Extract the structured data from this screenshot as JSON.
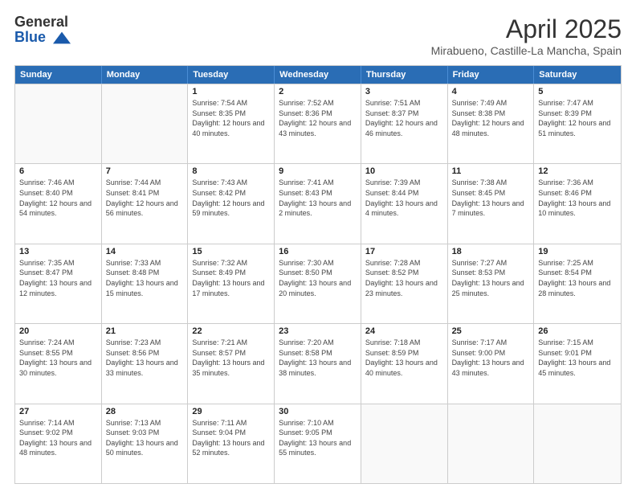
{
  "logo": {
    "general": "General",
    "blue": "Blue"
  },
  "header": {
    "month": "April 2025",
    "location": "Mirabueno, Castille-La Mancha, Spain"
  },
  "days_of_week": [
    "Sunday",
    "Monday",
    "Tuesday",
    "Wednesday",
    "Thursday",
    "Friday",
    "Saturday"
  ],
  "weeks": [
    [
      {
        "day": "",
        "sunrise": "",
        "sunset": "",
        "daylight": "",
        "empty": true
      },
      {
        "day": "",
        "sunrise": "",
        "sunset": "",
        "daylight": "",
        "empty": true
      },
      {
        "day": "1",
        "sunrise": "Sunrise: 7:54 AM",
        "sunset": "Sunset: 8:35 PM",
        "daylight": "Daylight: 12 hours and 40 minutes.",
        "empty": false
      },
      {
        "day": "2",
        "sunrise": "Sunrise: 7:52 AM",
        "sunset": "Sunset: 8:36 PM",
        "daylight": "Daylight: 12 hours and 43 minutes.",
        "empty": false
      },
      {
        "day": "3",
        "sunrise": "Sunrise: 7:51 AM",
        "sunset": "Sunset: 8:37 PM",
        "daylight": "Daylight: 12 hours and 46 minutes.",
        "empty": false
      },
      {
        "day": "4",
        "sunrise": "Sunrise: 7:49 AM",
        "sunset": "Sunset: 8:38 PM",
        "daylight": "Daylight: 12 hours and 48 minutes.",
        "empty": false
      },
      {
        "day": "5",
        "sunrise": "Sunrise: 7:47 AM",
        "sunset": "Sunset: 8:39 PM",
        "daylight": "Daylight: 12 hours and 51 minutes.",
        "empty": false
      }
    ],
    [
      {
        "day": "6",
        "sunrise": "Sunrise: 7:46 AM",
        "sunset": "Sunset: 8:40 PM",
        "daylight": "Daylight: 12 hours and 54 minutes.",
        "empty": false
      },
      {
        "day": "7",
        "sunrise": "Sunrise: 7:44 AM",
        "sunset": "Sunset: 8:41 PM",
        "daylight": "Daylight: 12 hours and 56 minutes.",
        "empty": false
      },
      {
        "day": "8",
        "sunrise": "Sunrise: 7:43 AM",
        "sunset": "Sunset: 8:42 PM",
        "daylight": "Daylight: 12 hours and 59 minutes.",
        "empty": false
      },
      {
        "day": "9",
        "sunrise": "Sunrise: 7:41 AM",
        "sunset": "Sunset: 8:43 PM",
        "daylight": "Daylight: 13 hours and 2 minutes.",
        "empty": false
      },
      {
        "day": "10",
        "sunrise": "Sunrise: 7:39 AM",
        "sunset": "Sunset: 8:44 PM",
        "daylight": "Daylight: 13 hours and 4 minutes.",
        "empty": false
      },
      {
        "day": "11",
        "sunrise": "Sunrise: 7:38 AM",
        "sunset": "Sunset: 8:45 PM",
        "daylight": "Daylight: 13 hours and 7 minutes.",
        "empty": false
      },
      {
        "day": "12",
        "sunrise": "Sunrise: 7:36 AM",
        "sunset": "Sunset: 8:46 PM",
        "daylight": "Daylight: 13 hours and 10 minutes.",
        "empty": false
      }
    ],
    [
      {
        "day": "13",
        "sunrise": "Sunrise: 7:35 AM",
        "sunset": "Sunset: 8:47 PM",
        "daylight": "Daylight: 13 hours and 12 minutes.",
        "empty": false
      },
      {
        "day": "14",
        "sunrise": "Sunrise: 7:33 AM",
        "sunset": "Sunset: 8:48 PM",
        "daylight": "Daylight: 13 hours and 15 minutes.",
        "empty": false
      },
      {
        "day": "15",
        "sunrise": "Sunrise: 7:32 AM",
        "sunset": "Sunset: 8:49 PM",
        "daylight": "Daylight: 13 hours and 17 minutes.",
        "empty": false
      },
      {
        "day": "16",
        "sunrise": "Sunrise: 7:30 AM",
        "sunset": "Sunset: 8:50 PM",
        "daylight": "Daylight: 13 hours and 20 minutes.",
        "empty": false
      },
      {
        "day": "17",
        "sunrise": "Sunrise: 7:28 AM",
        "sunset": "Sunset: 8:52 PM",
        "daylight": "Daylight: 13 hours and 23 minutes.",
        "empty": false
      },
      {
        "day": "18",
        "sunrise": "Sunrise: 7:27 AM",
        "sunset": "Sunset: 8:53 PM",
        "daylight": "Daylight: 13 hours and 25 minutes.",
        "empty": false
      },
      {
        "day": "19",
        "sunrise": "Sunrise: 7:25 AM",
        "sunset": "Sunset: 8:54 PM",
        "daylight": "Daylight: 13 hours and 28 minutes.",
        "empty": false
      }
    ],
    [
      {
        "day": "20",
        "sunrise": "Sunrise: 7:24 AM",
        "sunset": "Sunset: 8:55 PM",
        "daylight": "Daylight: 13 hours and 30 minutes.",
        "empty": false
      },
      {
        "day": "21",
        "sunrise": "Sunrise: 7:23 AM",
        "sunset": "Sunset: 8:56 PM",
        "daylight": "Daylight: 13 hours and 33 minutes.",
        "empty": false
      },
      {
        "day": "22",
        "sunrise": "Sunrise: 7:21 AM",
        "sunset": "Sunset: 8:57 PM",
        "daylight": "Daylight: 13 hours and 35 minutes.",
        "empty": false
      },
      {
        "day": "23",
        "sunrise": "Sunrise: 7:20 AM",
        "sunset": "Sunset: 8:58 PM",
        "daylight": "Daylight: 13 hours and 38 minutes.",
        "empty": false
      },
      {
        "day": "24",
        "sunrise": "Sunrise: 7:18 AM",
        "sunset": "Sunset: 8:59 PM",
        "daylight": "Daylight: 13 hours and 40 minutes.",
        "empty": false
      },
      {
        "day": "25",
        "sunrise": "Sunrise: 7:17 AM",
        "sunset": "Sunset: 9:00 PM",
        "daylight": "Daylight: 13 hours and 43 minutes.",
        "empty": false
      },
      {
        "day": "26",
        "sunrise": "Sunrise: 7:15 AM",
        "sunset": "Sunset: 9:01 PM",
        "daylight": "Daylight: 13 hours and 45 minutes.",
        "empty": false
      }
    ],
    [
      {
        "day": "27",
        "sunrise": "Sunrise: 7:14 AM",
        "sunset": "Sunset: 9:02 PM",
        "daylight": "Daylight: 13 hours and 48 minutes.",
        "empty": false
      },
      {
        "day": "28",
        "sunrise": "Sunrise: 7:13 AM",
        "sunset": "Sunset: 9:03 PM",
        "daylight": "Daylight: 13 hours and 50 minutes.",
        "empty": false
      },
      {
        "day": "29",
        "sunrise": "Sunrise: 7:11 AM",
        "sunset": "Sunset: 9:04 PM",
        "daylight": "Daylight: 13 hours and 52 minutes.",
        "empty": false
      },
      {
        "day": "30",
        "sunrise": "Sunrise: 7:10 AM",
        "sunset": "Sunset: 9:05 PM",
        "daylight": "Daylight: 13 hours and 55 minutes.",
        "empty": false
      },
      {
        "day": "",
        "sunrise": "",
        "sunset": "",
        "daylight": "",
        "empty": true
      },
      {
        "day": "",
        "sunrise": "",
        "sunset": "",
        "daylight": "",
        "empty": true
      },
      {
        "day": "",
        "sunrise": "",
        "sunset": "",
        "daylight": "",
        "empty": true
      }
    ]
  ]
}
